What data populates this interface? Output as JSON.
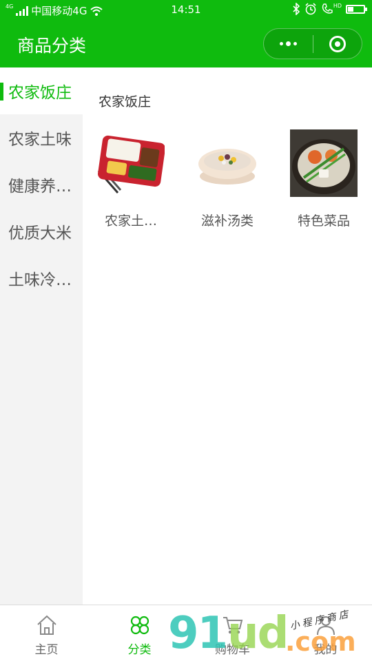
{
  "status_bar": {
    "network": "4G",
    "carrier": "中国移动4G",
    "time": "14:51",
    "hd": "HD"
  },
  "nav": {
    "title": "商品分类"
  },
  "sidebar": {
    "items": [
      {
        "label": "农家饭庄"
      },
      {
        "label": "农家土味"
      },
      {
        "label": "健康养…"
      },
      {
        "label": "优质大米"
      },
      {
        "label": "土味冷…"
      }
    ]
  },
  "main": {
    "section_title": "农家饭庄",
    "products": [
      {
        "label": "农家土…",
        "icon": "bento-box-image"
      },
      {
        "label": "滋补汤类",
        "icon": "soup-bowl-image"
      },
      {
        "label": "特色菜品",
        "icon": "crab-pot-image"
      }
    ]
  },
  "tab_bar": {
    "tabs": [
      {
        "label": "主页",
        "icon": "home-icon"
      },
      {
        "label": "分类",
        "icon": "category-icon"
      },
      {
        "label": "购物车",
        "icon": "cart-icon"
      },
      {
        "label": "我的",
        "icon": "user-icon"
      }
    ]
  },
  "watermark": {
    "logo": "91ud.com",
    "caption": "小程序商店"
  },
  "colors": {
    "brand_green": "#0fbb0e",
    "sidebar_bg": "#f3f3f3",
    "text_gray": "#555555"
  }
}
